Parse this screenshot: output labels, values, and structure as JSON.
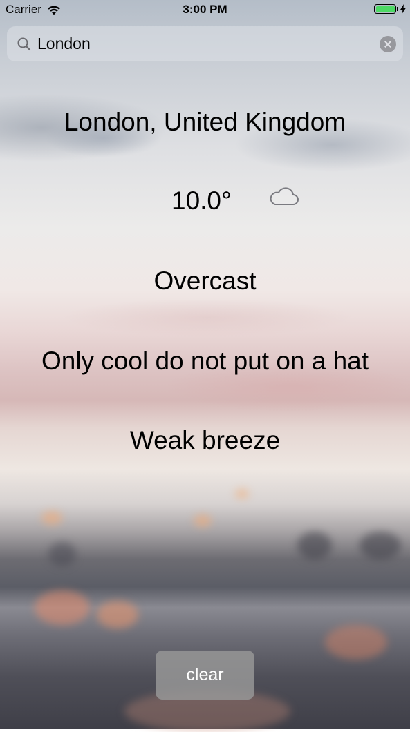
{
  "status_bar": {
    "carrier": "Carrier",
    "time": "3:00 PM",
    "wifi_icon": "wifi-icon",
    "battery_icon": "battery-charging-icon",
    "battery_color": "#4cd964"
  },
  "search": {
    "value": "London",
    "icon": "search-icon",
    "clear_icon": "clear-circle-icon"
  },
  "weather": {
    "location": "London, United Kingdom",
    "temperature": "10.0°",
    "condition_icon": "cloud-icon",
    "condition": "Overcast",
    "advice": "Only cool do not put on a hat",
    "wind": "Weak breeze"
  },
  "actions": {
    "clear_label": "clear"
  }
}
